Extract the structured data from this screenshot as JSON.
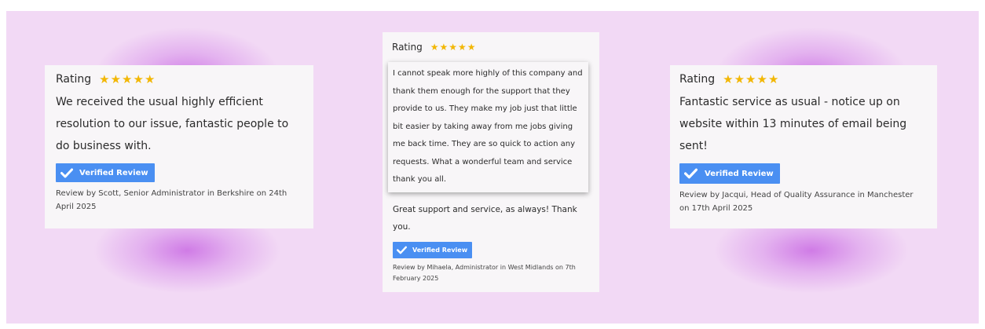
{
  "colors": {
    "panel_bg": "#f2d9f5",
    "glow": "#c45ce1",
    "card_bg": "#f8f6f8",
    "star": "#f2b705",
    "badge": "#4a8ff2"
  },
  "reviews": [
    {
      "rating_label": "Rating",
      "stars": 5,
      "text": "We received the usual highly efficient resolution to our issue, fantastic people to do business with.",
      "badge": "Verified Review",
      "byline": "Review by Scott, Senior Administrator in Berkshire on 24th April 2025"
    },
    {
      "rating_label": "Rating",
      "stars": 5,
      "overlay_text": "I cannot speak more highly of this company and thank them enough for the support that they provide to us. They make my job just that little bit easier by taking away from me jobs giving me back time. They are so quick to action any requests. What a wonderful team and service thank you all.",
      "text": "Great support and service, as always! Thank you.",
      "badge": "Verified Review",
      "byline": "Review by Mihaela, Administrator in West Midlands on 7th February 2025"
    },
    {
      "rating_label": "Rating",
      "stars": 5,
      "text": "Fantastic service as usual - notice up on website within 13 minutes of email being sent!",
      "badge": "Verified Review",
      "byline": "Review by Jacqui, Head of Quality Assurance in Manchester on 17th April 2025"
    }
  ],
  "icons": {
    "star": "star-icon",
    "check": "check-icon"
  }
}
